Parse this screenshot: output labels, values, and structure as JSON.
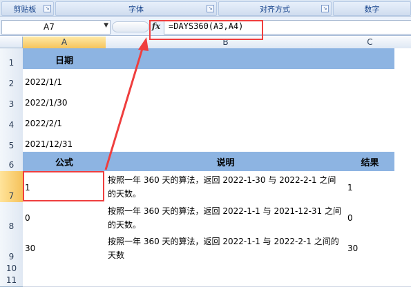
{
  "ribbon": {
    "groups": [
      "剪贴板",
      "字体",
      "对齐方式",
      "数字"
    ]
  },
  "formula_bar": {
    "name_box": "A7",
    "fx_label": "fx",
    "formula": "=DAYS360(A3,A4)"
  },
  "columns": [
    "A",
    "B",
    "C"
  ],
  "rows": [
    "1",
    "2",
    "3",
    "4",
    "5",
    "6",
    "7",
    "8",
    "9",
    "10",
    "11"
  ],
  "sheet": {
    "a1": "日期",
    "dates": [
      "2022/1/1",
      "2022/1/30",
      "2022/2/1",
      "2021/12/31"
    ],
    "header_formula": "公式",
    "header_desc": "说明",
    "header_result": "结果",
    "data_rows": [
      {
        "a": "1",
        "b": "按照一年 360 天的算法，返回 2022-1-30 与 2022-2-1 之间的天数。",
        "c": "1"
      },
      {
        "a": "0",
        "b": "按照一年 360 天的算法，返回 2022-1-1 与 2021-12-31 之间的天数。",
        "c": "0"
      },
      {
        "a": "30",
        "b": "按照一年 360 天的算法，返回 2022-1-1 与 2022-2-1 之间的天数",
        "c": "30"
      }
    ]
  },
  "colors": {
    "header_fill": "#8db4e2",
    "highlight": "#ef3e3e"
  }
}
